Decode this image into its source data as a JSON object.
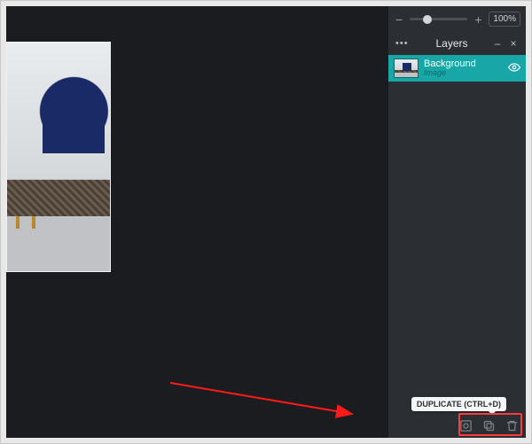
{
  "zoom": {
    "minus_label": "−",
    "plus_label": "+",
    "value_label": "100%",
    "thumb_pct": 30
  },
  "panel": {
    "menu_dots": "•••",
    "title": "Layers",
    "minimize_glyph": "–",
    "close_glyph": "×"
  },
  "layers": [
    {
      "name": "Background",
      "type": "Image",
      "visible": true
    }
  ],
  "actions": {
    "add_mask_name": "add-mask-icon",
    "duplicate_name": "duplicate-icon",
    "delete_name": "delete-icon"
  },
  "tooltip": {
    "text": "DUPLICATE (CTRL+D)"
  },
  "colors": {
    "accent": "#18a7a6",
    "annotation": "#ff3a3a"
  }
}
